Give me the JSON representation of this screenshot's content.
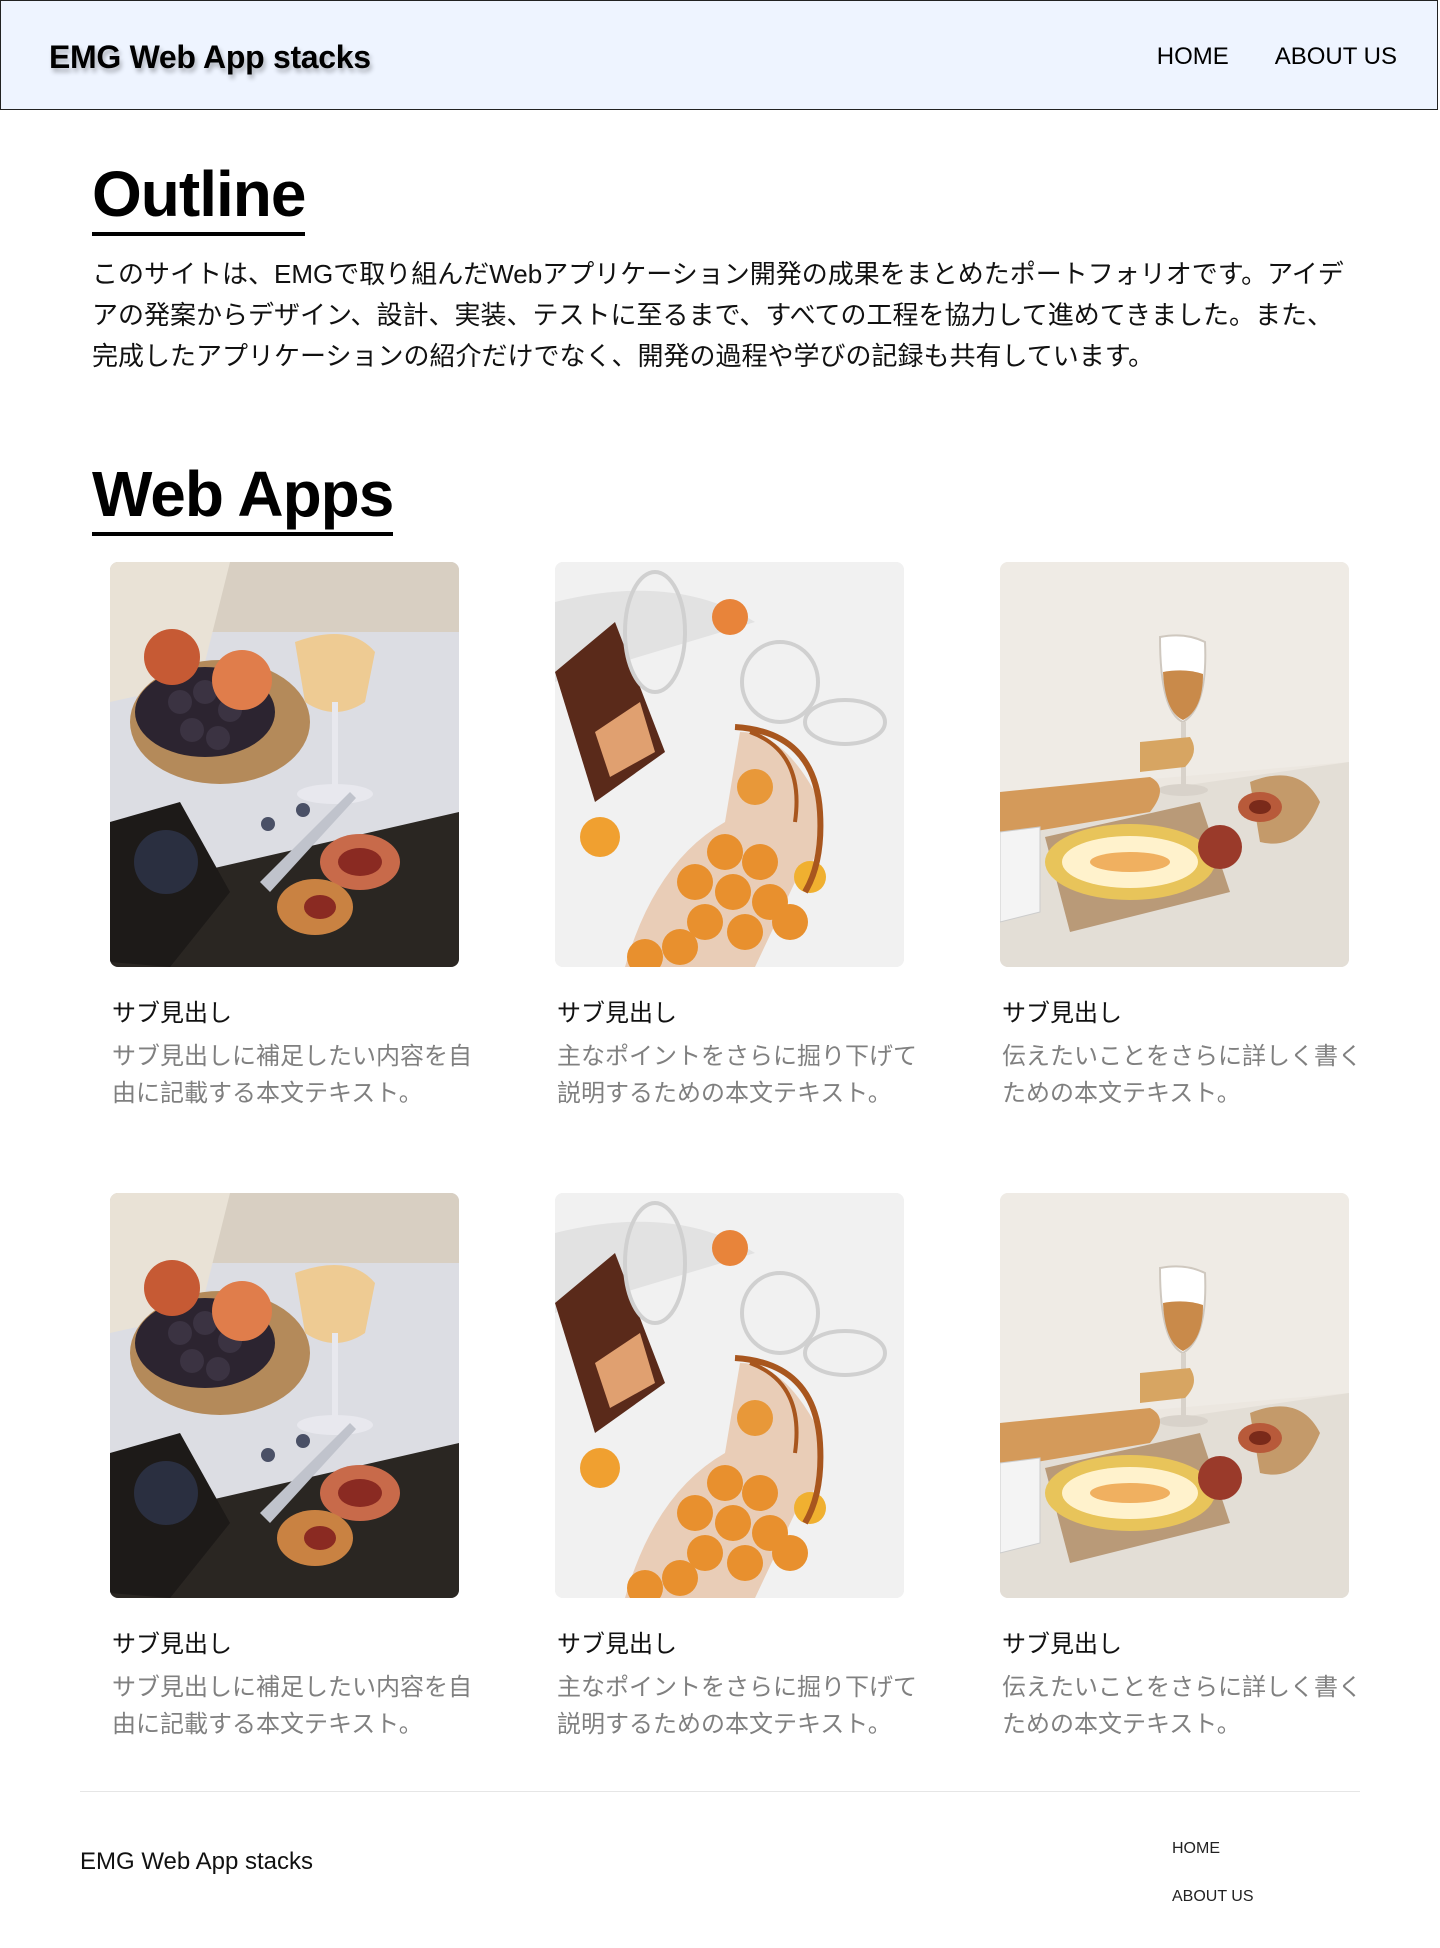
{
  "header": {
    "brand": "EMG Web App stacks",
    "nav": [
      "HOME",
      "ABOUT US"
    ]
  },
  "outline": {
    "title": "Outline",
    "text": "このサイトは、EMGで取り組んだWebアプリケーション開発の成果をまとめたポートフォリオです。アイデアの発案からデザイン、設計、実装、テストに至るまで、すべての工程を協力して進めてきました。また、完成したアプリケーションの紹介だけでなく、開発の過程や学びの記録も共有しています。"
  },
  "apps": {
    "title": "Web Apps",
    "cards": [
      {
        "image": "fruit-wine-picnic-photo",
        "title": "サブ見出し",
        "desc": "サブ見出しに補足したい内容を自由に記載する本文テキスト。"
      },
      {
        "image": "peaches-glasses-net-bag-photo",
        "title": "サブ見出し",
        "desc": "主なポイントをさらに掘り下げて説明するための本文テキスト。"
      },
      {
        "image": "wine-bread-melon-photo",
        "title": "サブ見出し",
        "desc": "伝えたいことをさらに詳しく書くための本文テキスト。"
      },
      {
        "image": "fruit-wine-picnic-photo",
        "title": "サブ見出し",
        "desc": "サブ見出しに補足したい内容を自由に記載する本文テキスト。"
      },
      {
        "image": "peaches-glasses-net-bag-photo",
        "title": "サブ見出し",
        "desc": "主なポイントをさらに掘り下げて説明するための本文テキスト。"
      },
      {
        "image": "wine-bread-melon-photo",
        "title": "サブ見出し",
        "desc": "伝えたいことをさらに詳しく書くための本文テキスト。"
      }
    ]
  },
  "footer": {
    "brand": "EMG Web App stacks",
    "nav": [
      "HOME",
      "ABOUT US"
    ]
  },
  "colors": {
    "header_bg": "#eef4ff",
    "body_text": "#111111",
    "muted_text": "#808080"
  }
}
